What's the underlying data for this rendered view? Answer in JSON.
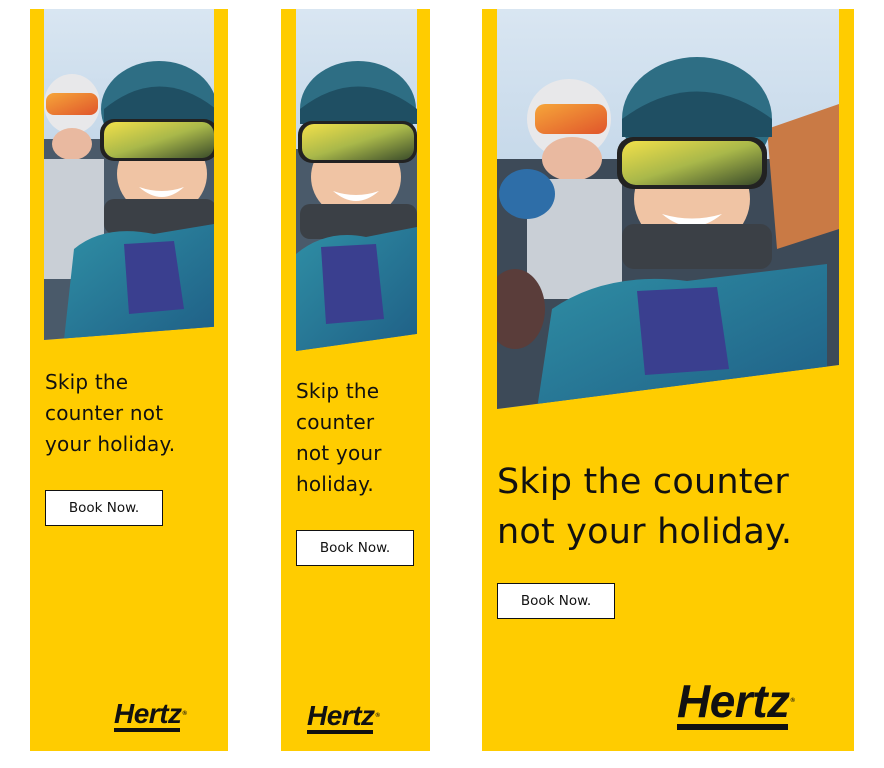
{
  "banners": [
    {
      "headline_lines": [
        "Skip the",
        "counter not",
        "your holiday."
      ],
      "button_label": "Book Now.",
      "logo_text": "Hertz",
      "logo_mark": "®"
    },
    {
      "headline_lines": [
        "Skip the",
        "counter",
        "not your",
        "holiday."
      ],
      "button_label": "Book Now.",
      "logo_text": "Hertz",
      "logo_mark": "®"
    },
    {
      "headline_lines": [
        "Skip the counter",
        "not your holiday."
      ],
      "button_label": "Book Now.",
      "logo_text": "Hertz",
      "logo_mark": "®"
    }
  ],
  "colors": {
    "brand_yellow": "#ffcc00",
    "text_dark": "#111111",
    "button_bg": "#ffffff"
  },
  "image": {
    "subject": "smiling-child-skier-photo"
  }
}
